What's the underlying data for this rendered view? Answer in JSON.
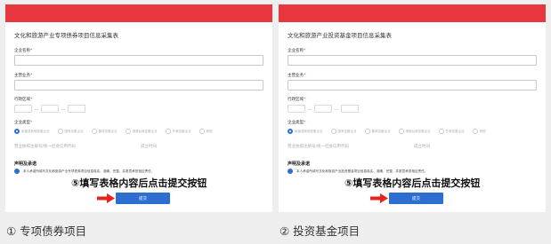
{
  "panels": [
    {
      "form_title": "文化和旅游产业专项债券项目信息采集表",
      "company_name_label": "企业名称",
      "main_business_label": "主营业务",
      "region_label": "行政区域",
      "company_type_label": "企业类型",
      "company_types": [
        "私营或其他控股企业",
        "国有控股企业",
        "集体控股企业",
        "港澳台商控股企业",
        "外商控股企业",
        "其他"
      ],
      "credit_code_label": "营业执照注册号/统一社会信用代码",
      "established_label": "成立时间",
      "declaration_title": "声明及承诺",
      "agreement_text": "本人承诺所填写文化和旅游产业专项债券项目信息真实、准确、完整，并愿意承担相应责任。",
      "annotation": "⑤填写表格内容后点击提交按钮",
      "submit_label": "提交"
    },
    {
      "form_title": "文化和旅游产业投资基金项目信息采集表",
      "company_name_label": "企业名称",
      "main_business_label": "主营业务",
      "region_label": "行政区域",
      "company_type_label": "企业类型",
      "company_types": [
        "私营或其他控股企业",
        "国有控股企业",
        "集体控股企业",
        "港澳台商控股企业",
        "外商控股企业",
        "其他"
      ],
      "credit_code_label": "营业执照注册号/统一社会信用代码",
      "established_label": "成立时间",
      "declaration_title": "声明及承诺",
      "agreement_text": "本人承诺所填写文化和旅游产业投资基金项目信息真实、准确、完整，并愿意承担相应责任。",
      "annotation": "⑤填写表格内容后点击提交按钮",
      "submit_label": "提交"
    }
  ],
  "captions": [
    "① 专项债券项目",
    "② 投资基金项目"
  ],
  "required_mark": "*",
  "region_separator": "—",
  "colors": {
    "header_red": "#e8373f",
    "accent_blue": "#2c6fd1",
    "annotation_arrow": "#e8231d"
  }
}
